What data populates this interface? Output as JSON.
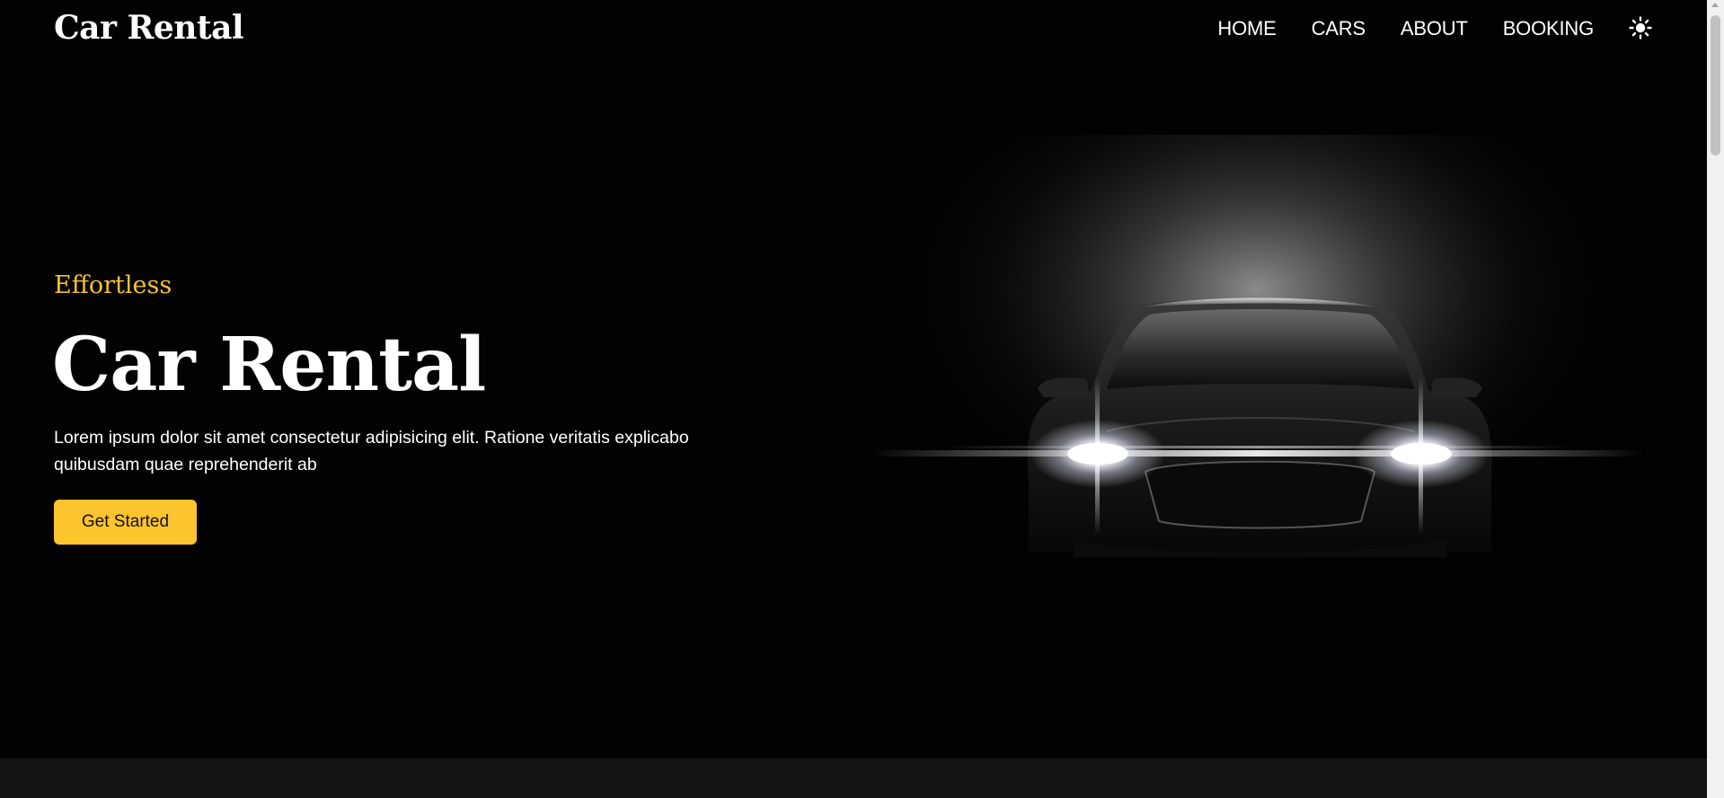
{
  "navbar": {
    "brand": "Car Rental",
    "links": [
      {
        "label": "HOME"
      },
      {
        "label": "CARS"
      },
      {
        "label": "ABOUT"
      },
      {
        "label": "BOOKING"
      }
    ],
    "theme_toggle_icon": "sun-icon"
  },
  "hero": {
    "eyebrow": "Effortless",
    "title": "Car Rental",
    "description": "Lorem ipsum dolor sit amet consectetur adipisicing elit. Ratione veritatis explicabo quibusdam quae reprehenderit ab",
    "cta_label": "Get Started",
    "image": "car-front-headlights-image"
  },
  "colors": {
    "background": "#020202",
    "accent": "#fcc42d",
    "eyebrow": "#f6c42f",
    "text": "#ffffff",
    "section_strip": "#141414"
  }
}
